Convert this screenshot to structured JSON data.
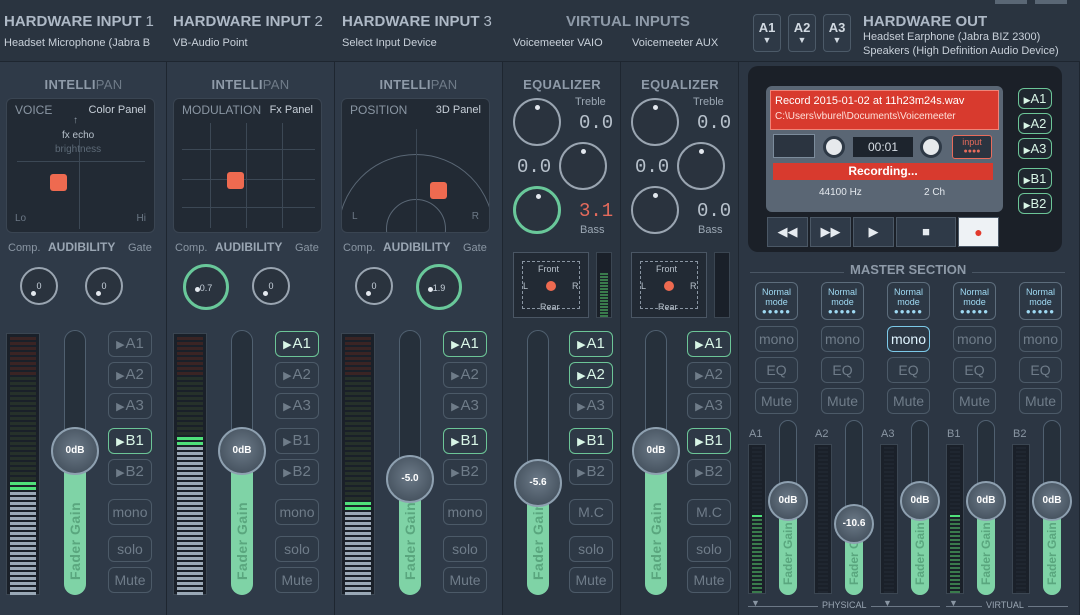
{
  "header": {
    "inputs": [
      {
        "title": "HARDWARE INPUT",
        "num": "1",
        "device": "Headset Microphone (Jabra B"
      },
      {
        "title": "HARDWARE INPUT",
        "num": "2",
        "device": "VB-Audio Point"
      },
      {
        "title": "HARDWARE INPUT",
        "num": "3",
        "device": "Select Input Device"
      }
    ],
    "virtual_title": "VIRTUAL INPUTS",
    "virtual_devices": [
      "Voicemeeter VAIO",
      "Voicemeeter AUX"
    ],
    "ab_buttons": [
      "A1",
      "A2",
      "A3"
    ],
    "hw_out_title": "HARDWARE OUT",
    "hw_out_devices": [
      "Headset Earphone (Jabra BIZ 2300)",
      "Speakers (High Definition Audio Device)"
    ]
  },
  "strips": [
    {
      "intellipan_a": "INTELLI",
      "intellipan_b": "PAN",
      "panel_left": "VOICE",
      "panel_right": "Color Panel",
      "pad_extra1": "fx echo",
      "pad_extra2": "brightness",
      "pad_lo": "Lo",
      "pad_hi": "Hi",
      "comp": "Comp.",
      "audibility": "AUDIBILITY",
      "gate": "Gate",
      "knob1": "0",
      "knob2": "0",
      "fader_value": "0dB",
      "fader_label": "Fader Gain",
      "fader_level": 0.55,
      "meter_level": 0.45,
      "buses": [
        "A1",
        "A2",
        "A3",
        "B1",
        "B2"
      ],
      "bus_on": [
        false,
        false,
        false,
        true,
        false
      ],
      "mono": "mono",
      "solo": "solo",
      "mute": "Mute"
    },
    {
      "intellipan_a": "INTELLI",
      "intellipan_b": "PAN",
      "panel_left": "MODULATION",
      "panel_right": "Fx Panel",
      "comp": "Comp.",
      "audibility": "AUDIBILITY",
      "gate": "Gate",
      "knob1": "0.7",
      "knob2": "0",
      "fader_value": "0dB",
      "fader_label": "Fader Gain",
      "fader_level": 0.55,
      "meter_level": 0.62,
      "buses": [
        "A1",
        "A2",
        "A3",
        "B1",
        "B2"
      ],
      "bus_on": [
        true,
        false,
        false,
        false,
        false
      ],
      "mono": "mono",
      "solo": "solo",
      "mute": "Mute"
    },
    {
      "intellipan_a": "INTELLI",
      "intellipan_b": "PAN",
      "panel_left": "POSITION",
      "panel_right": "3D Panel",
      "pad_l": "L",
      "pad_r": "R",
      "comp": "Comp.",
      "audibility": "AUDIBILITY",
      "gate": "Gate",
      "knob1": "0",
      "knob2": "1.9",
      "fader_value": "-5.0",
      "fader_label": "Fader Gain",
      "fader_level": 0.42,
      "meter_level": 0.36,
      "buses": [
        "A1",
        "A2",
        "A3",
        "B1",
        "B2"
      ],
      "bus_on": [
        true,
        false,
        false,
        true,
        false
      ],
      "mono": "mono",
      "solo": "solo",
      "mute": "Mute"
    }
  ],
  "virtual_strips": [
    {
      "eq_title": "EQUALIZER",
      "treble_label": "Treble",
      "treble": "0.0",
      "mid": "0.0",
      "bass": "3.1",
      "bass_label": "Bass",
      "spk_front": "Front",
      "spk_rear": "Rear",
      "spk_l": "L",
      "spk_r": "R",
      "fader_value": "-5.6",
      "fader_label": "Fader Gain",
      "fader_level": 0.4,
      "buses": [
        "A1",
        "A2",
        "A3",
        "B1",
        "B2"
      ],
      "bus_on": [
        true,
        true,
        false,
        true,
        false
      ],
      "mc": "M.C",
      "solo": "solo",
      "mute": "Mute"
    },
    {
      "eq_title": "EQUALIZER",
      "treble_label": "Treble",
      "treble": "0.0",
      "mid": "0.0",
      "bass": "0.0",
      "bass_label": "Bass",
      "spk_front": "Front",
      "spk_rear": "Rear",
      "spk_l": "L",
      "spk_r": "R",
      "fader_value": "0dB",
      "fader_label": "Fader Gain",
      "fader_level": 0.55,
      "buses": [
        "A1",
        "A2",
        "A3",
        "B1",
        "B2"
      ],
      "bus_on": [
        true,
        false,
        false,
        true,
        false
      ],
      "mc": "M.C",
      "solo": "solo",
      "mute": "Mute"
    }
  ],
  "recorder": {
    "file": "Record 2015-01-02 at 11h23m24s.wav",
    "path": "C:\\Users\\vburel\\Documents\\Voicemeeter",
    "time": "00:01",
    "input_label": "input",
    "status": "Recording...",
    "rate": "44100 Hz",
    "channels": "2 Ch",
    "side_buttons": [
      "A1",
      "A2",
      "A3",
      "B1",
      "B2"
    ]
  },
  "master": {
    "title": "MASTER SECTION",
    "mode_label": "Normal mode",
    "mono": "mono",
    "eq": "EQ",
    "mute": "Mute",
    "mono_on": [
      false,
      false,
      true,
      false,
      false
    ],
    "buses": [
      {
        "name": "A1",
        "value": "0dB",
        "level": 0.55,
        "meter": 0.55
      },
      {
        "name": "A2",
        "value": "-10.6",
        "level": 0.38,
        "meter": 0.0
      },
      {
        "name": "A3",
        "value": "0dB",
        "level": 0.55,
        "meter": 0.0
      },
      {
        "name": "B1",
        "value": "0dB",
        "level": 0.55,
        "meter": 0.55
      },
      {
        "name": "B2",
        "value": "0dB",
        "level": 0.55,
        "meter": 0.0
      }
    ],
    "fader_label": "Fader Gain",
    "physical": "PHYSICAL",
    "virtual": "VIRTUAL"
  }
}
